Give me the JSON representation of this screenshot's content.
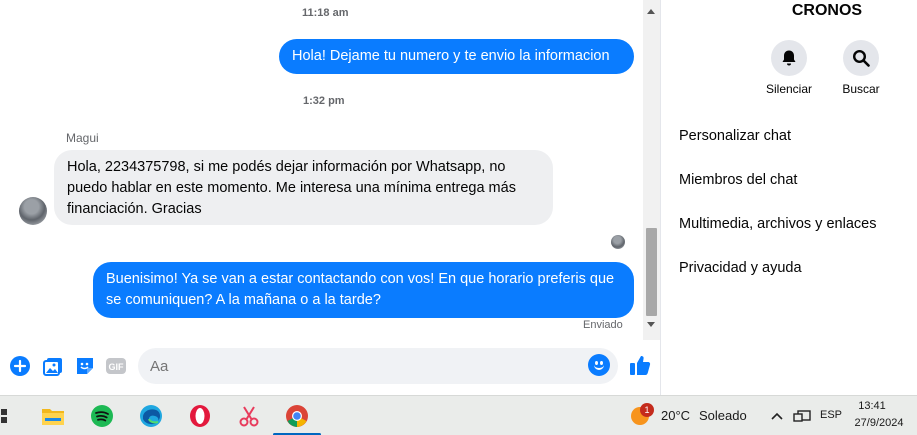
{
  "chat": {
    "time1": "11:18 am",
    "msg_out1": "Hola! Dejame tu numero y te envio la informacion",
    "time2": "1:32 pm",
    "sender": "Magui",
    "msg_in1": "Hola, 2234375798, si me podés dejar información por Whatsapp, no puedo hablar en este momento. Me interesa una mínima entrega más financiación. Gracias",
    "msg_out2": "Buenisimo! Ya se van a estar contactando con vos! En que horario preferis que se comuniquen? A la mañana o a la tarde?",
    "status": "Enviado"
  },
  "composer": {
    "placeholder": "Aa",
    "gif_label": "GIF"
  },
  "panel": {
    "title": "CRONOS",
    "mute_label": "Silenciar",
    "search_label": "Buscar",
    "menu": [
      "Personalizar chat",
      "Miembros del chat",
      "Multimedia, archivos y enlaces",
      "Privacidad y ayuda"
    ]
  },
  "taskbar": {
    "weather_temp": "20°C",
    "weather_desc": "Soleado",
    "weather_badge": "1",
    "language": "ESP",
    "clock_time": "13:41",
    "clock_date": "27/9/2024"
  },
  "colors": {
    "accent": "#0a7cff",
    "incoming_bubble": "#eeeff1"
  }
}
